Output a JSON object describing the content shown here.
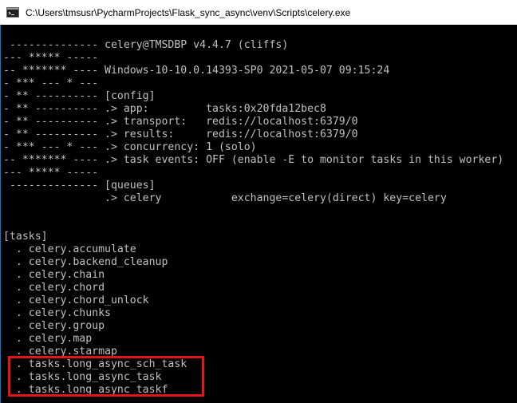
{
  "window": {
    "title": "C:\\Users\\tmsusr\\PycharmProjects\\Flask_sync_async\\venv\\Scripts\\celery.exe",
    "icon": "console-icon"
  },
  "colors": {
    "console_bg": "#000000",
    "console_text": "#c0c0c0",
    "highlight": "#e21616",
    "titlebar_bg": "#ffffff"
  },
  "console": {
    "lines": [
      "",
      " -------------- celery@TMSDBP v4.4.7 (cliffs)",
      "--- ***** -----",
      "-- ******* ---- Windows-10-10.0.14393-SP0 2021-05-07 09:15:24",
      "- *** --- * ---",
      "- ** ---------- [config]",
      "- ** ---------- .> app:         tasks:0x20fda12bec8",
      "- ** ---------- .> transport:   redis://localhost:6379/0",
      "- ** ---------- .> results:     redis://localhost:6379/0",
      "- *** --- * --- .> concurrency: 1 (solo)",
      "-- ******* ---- .> task events: OFF (enable -E to monitor tasks in this worker)",
      "--- ***** -----",
      " -------------- [queues]",
      "                .> celery           exchange=celery(direct) key=celery",
      "",
      "",
      "[tasks]",
      "  . celery.accumulate",
      "  . celery.backend_cleanup",
      "  . celery.chain",
      "  . celery.chord",
      "  . celery.chord_unlock",
      "  . celery.chunks",
      "  . celery.group",
      "  . celery.map",
      "  . celery.starmap",
      "  . tasks.long_async_sch_task",
      "  . tasks.long_async_task",
      "  . tasks.long_async_taskf"
    ]
  }
}
